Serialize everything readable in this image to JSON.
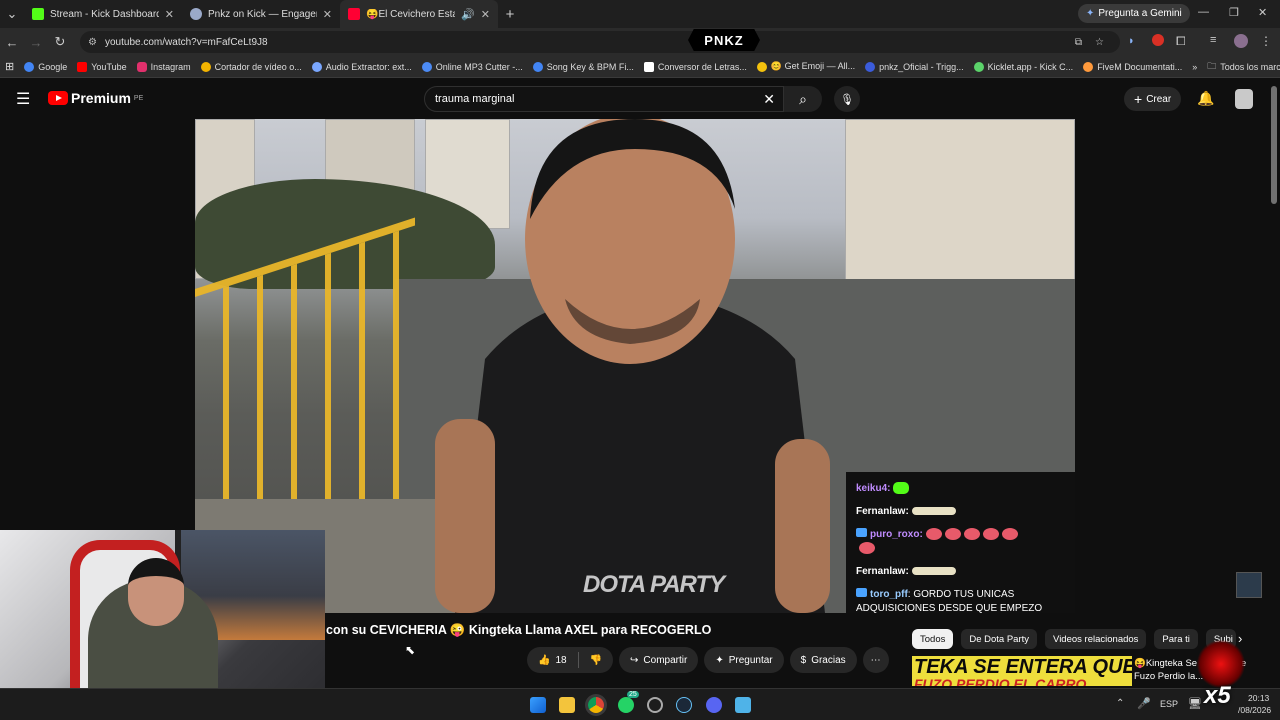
{
  "tabs": [
    {
      "title": "Stream - Kick Dashboard",
      "color": "#53fc18"
    },
    {
      "title": "Pnkz on Kick — Engagement A",
      "color": "#9aa9c9"
    },
    {
      "title": "😝El Cevichero Esta a PUN",
      "color": "#ff0033"
    }
  ],
  "gemini_label": "Pregunta a Gemini",
  "url": "youtube.com/watch?v=mFafCeLt9J8",
  "pnkz_badge": "PNKZ",
  "bookmarks": [
    "Google",
    "YouTube",
    "Instagram",
    "Cortador de vídeo o...",
    "Audio Extractor: ext...",
    "Online MP3 Cutter -...",
    "Song Key & BPM Fi...",
    "Conversor de Letras...",
    "😊 Get Emoji — All...",
    "pnkz_Oficial - Trigg...",
    "Kicklet.app - Kick C...",
    "FiveM Documentati..."
  ],
  "bookmark_colors": [
    "#4285f4",
    "#ff0000",
    "#e1306c",
    "#f4b400",
    "#7aa7ff",
    "#4c8bf5",
    "#4285f4",
    "#fff",
    "#f4c20d",
    "#3b5cdb",
    "#5bd36a",
    "#ff9a3c"
  ],
  "all_bookmarks": "Todos los marcadores",
  "youtube": {
    "brand": "Premium",
    "region": "PE",
    "search_value": "trauma marginal",
    "create_label": "Crear"
  },
  "video": {
    "watermark": "DOTA PARTY"
  },
  "chat": [
    {
      "user": "keiku4",
      "text": "",
      "emotes": 0
    },
    {
      "user": "Fernanlaw",
      "text": "",
      "emotes": 0
    },
    {
      "user": "puro_roxo",
      "text": "",
      "emotes": 6
    },
    {
      "user": "Fernanlaw",
      "text": "",
      "emotes": 0
    },
    {
      "user": "toro_pff",
      "text": "GORDO TUS UNICAS ADQUISICIONES DESDE QUE EMPEZO",
      "emotes": 0
    }
  ],
  "video_title": "con su CEVICHERIA 😜 Kingteka Llama AXEL para RECOGERLO",
  "actions": {
    "likes": "18",
    "share": "Compartir",
    "ask": "Preguntar",
    "thanks": "Gracias"
  },
  "chips": [
    "Todos",
    "De Dota Party",
    "Videos relacionados",
    "Para ti",
    "Subi"
  ],
  "recommended": {
    "thumb_text": "TEKA SE ENTERA QUE",
    "thumb_sub": "FUZO PERDIO EL CARRO",
    "title": "😝Kingteka Se Entera que Fuzo Perdio la..."
  },
  "taskbar": {
    "lang": "ESP",
    "time": "20:13",
    "date": "/08/2026",
    "badge1": "25"
  },
  "overlay_x5": "x5"
}
